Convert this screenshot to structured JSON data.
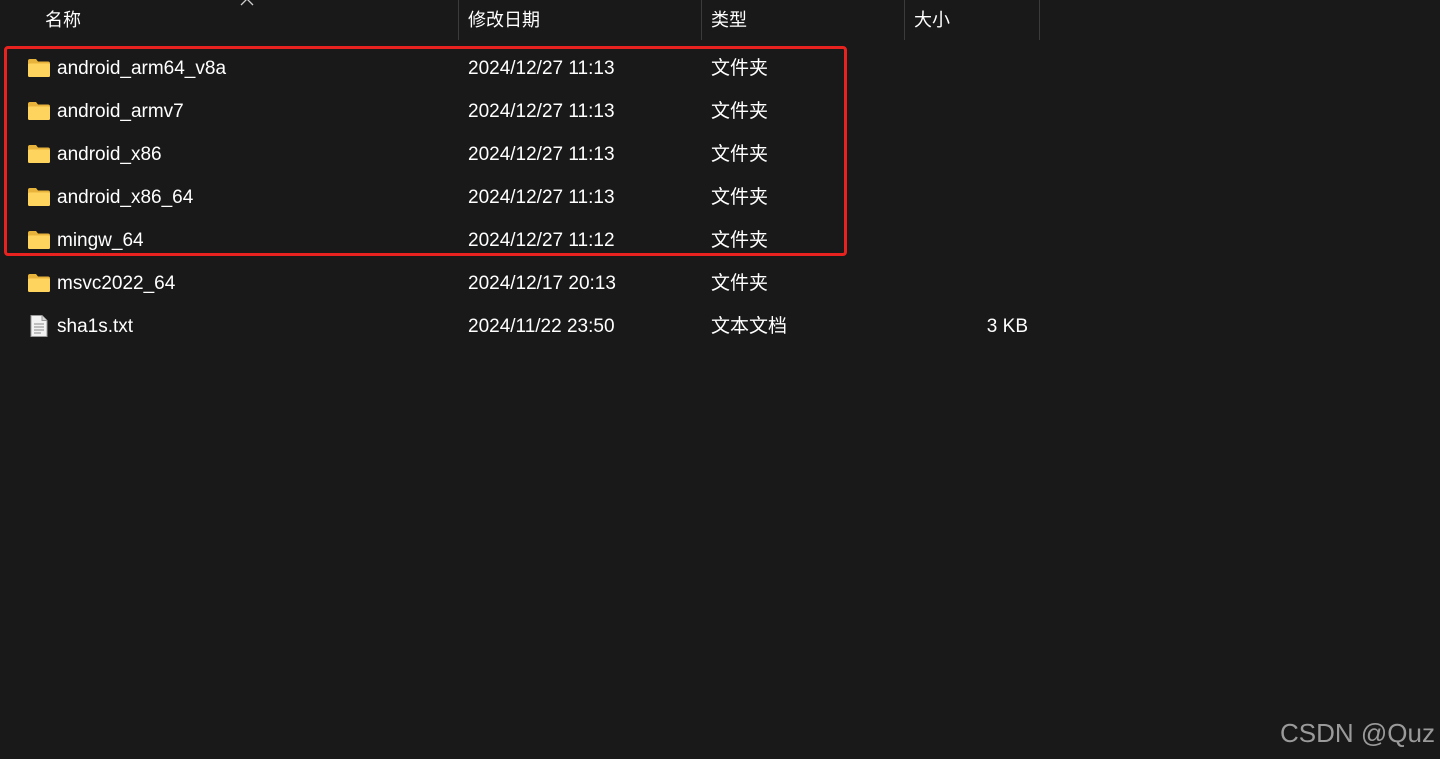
{
  "columns": {
    "name": "名称",
    "modified": "修改日期",
    "type": "类型",
    "size": "大小"
  },
  "files": [
    {
      "icon": "folder-icon",
      "name": "android_arm64_v8a",
      "modified": "2024/12/27 11:13",
      "type": "文件夹",
      "size": ""
    },
    {
      "icon": "folder-icon",
      "name": "android_armv7",
      "modified": "2024/12/27 11:13",
      "type": "文件夹",
      "size": ""
    },
    {
      "icon": "folder-icon",
      "name": "android_x86",
      "modified": "2024/12/27 11:13",
      "type": "文件夹",
      "size": ""
    },
    {
      "icon": "folder-icon",
      "name": "android_x86_64",
      "modified": "2024/12/27 11:13",
      "type": "文件夹",
      "size": ""
    },
    {
      "icon": "folder-icon",
      "name": "mingw_64",
      "modified": "2024/12/27 11:12",
      "type": "文件夹",
      "size": ""
    },
    {
      "icon": "folder-icon",
      "name": "msvc2022_64",
      "modified": "2024/12/17 20:13",
      "type": "文件夹",
      "size": ""
    },
    {
      "icon": "text-file-icon",
      "name": "sha1s.txt",
      "modified": "2024/11/22 23:50",
      "type": "文本文档",
      "size": "3 KB"
    }
  ],
  "highlight_color": "#e8231f",
  "watermark": "CSDN @Quz"
}
